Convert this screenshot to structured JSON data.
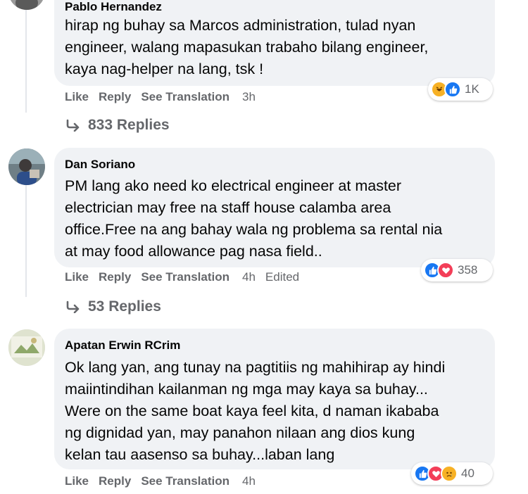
{
  "comments": [
    {
      "author": "Pablo Hernandez",
      "lines": [
        "hirap ng buhay sa Marcos administration, tulad nyan",
        "engineer, walang mapasukan trabaho bilang engineer,",
        "kaya nag-helper na lang, tsk !"
      ],
      "actions": {
        "like": "Like",
        "reply": "Reply",
        "translate": "See Translation",
        "time": "3h",
        "edited": ""
      },
      "reactions": {
        "icons": [
          "haha-icon",
          "like-icon"
        ],
        "count": "1K"
      },
      "replies": "833 Replies"
    },
    {
      "author": "Dan Soriano",
      "lines": [
        "PM lang ako need ko electrical engineer at master",
        "electrician may free na staff house calamba area",
        "office.Free na ang bahay wala ng problema sa rental nia",
        "at may food allowance pag nasa field.."
      ],
      "actions": {
        "like": "Like",
        "reply": "Reply",
        "translate": "See Translation",
        "time": "4h",
        "edited": "Edited"
      },
      "reactions": {
        "icons": [
          "like-icon",
          "love-icon"
        ],
        "count": "358"
      },
      "replies": "53 Replies"
    },
    {
      "author": "Apatan Erwin RCrim",
      "lines": [
        "Ok lang yan, ang tunay na pagtitiis ng mahihirap ay hindi",
        "maiintindihan kailanman ng mga may kaya sa buhay...",
        "Were on the same boat kaya feel kita, d naman ikababa",
        "ng dignidad yan, may panahon nilaan ang dios kung",
        "kelan tau aasenso sa buhay...laban lang"
      ],
      "actions": {
        "like": "Like",
        "reply": "Reply",
        "translate": "See Translation",
        "time": "4h",
        "edited": ""
      },
      "reactions": {
        "icons": [
          "like-icon",
          "love-icon",
          "sad-icon"
        ],
        "count": "40"
      }
    }
  ],
  "colors": {
    "bubble": "#f0f2f5",
    "meta_text": "#65676b",
    "like_blue": "#1877f2",
    "love_red": "#f33e58",
    "emoji_yellow": "#f7b125"
  }
}
